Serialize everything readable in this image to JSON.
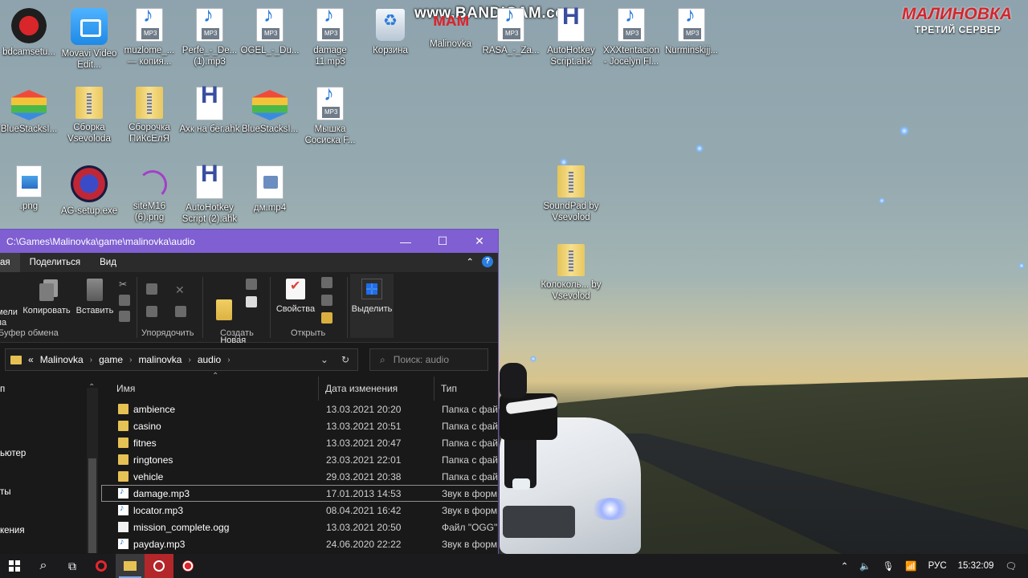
{
  "watermark": "www.BANDICAM.com",
  "brand": {
    "name": "МАЛИНОВКА",
    "server": "ТРЕТИЙ СЕРВЕР"
  },
  "desktop_icons": [
    {
      "label": "bdcamsetu..."
    },
    {
      "label": "Movavi Video Edit..."
    },
    {
      "label": "muzlome_... — копия..."
    },
    {
      "label": "Perfe_-_De... (1).mp3"
    },
    {
      "label": "OGEL_-_Du..."
    },
    {
      "label": "damage 11.mp3"
    },
    {
      "label": "Корзина"
    },
    {
      "label": "Malinovka"
    },
    {
      "label": "RASA_-_Za..."
    },
    {
      "label": "AutoHotkey Script.ahk"
    },
    {
      "label": "XXXtentacion - Jocelyn Fl..."
    },
    {
      "label": "Nurminskijj..."
    },
    {
      "label": "BlueStacksI..."
    },
    {
      "label": "Сборка Vsevoloda"
    },
    {
      "label": "Сборочка ПиКсЕлЯ"
    },
    {
      "label": "Ахк на бег.ahk"
    },
    {
      "label": "BlueStacksI..."
    },
    {
      "label": "Мышка Сосиска F..."
    },
    {
      "label": ".png"
    },
    {
      "label": "AG-setup.exe"
    },
    {
      "label": "siteM16 (6).png"
    },
    {
      "label": "AutoHotkey Script (2).ahk"
    },
    {
      "label": "дм.mp4"
    },
    {
      "label": "SoundPad by Vsevolod"
    },
    {
      "label": "Колоколь... by Vsevolod"
    }
  ],
  "explorer": {
    "title": "C:\\Games\\Malinovka\\game\\malinovka\\audio",
    "tabs": [
      "ая",
      "Поделиться",
      "Вид"
    ],
    "ribbon": {
      "pin": "мели\nпа",
      "copy": "Копировать",
      "paste": "Вставить",
      "new_folder": "Новая\nпапка",
      "properties": "Свойства",
      "select": "Выделить",
      "groups": {
        "clipboard": "Буфер обмена",
        "organize": "Упорядочить",
        "create": "Создать",
        "open": "Открыть"
      }
    },
    "breadcrumb": [
      "Malinovka",
      "game",
      "malinovka",
      "audio"
    ],
    "breadcrumb_prefix": "«",
    "search_placeholder": "Поиск: audio",
    "nav_items": [
      "п",
      "ьютер",
      "ты",
      "кения"
    ],
    "columns": {
      "name": "Имя",
      "date": "Дата изменения",
      "type": "Тип"
    },
    "files": [
      {
        "name": "ambience",
        "date": "13.03.2021 20:20",
        "type": "Папка с фай",
        "kind": "folder"
      },
      {
        "name": "casino",
        "date": "13.03.2021 20:51",
        "type": "Папка с фай",
        "kind": "folder"
      },
      {
        "name": "fitnes",
        "date": "13.03.2021 20:47",
        "type": "Папка с фай",
        "kind": "folder"
      },
      {
        "name": "ringtones",
        "date": "23.03.2021 22:01",
        "type": "Папка с фай",
        "kind": "folder"
      },
      {
        "name": "vehicle",
        "date": "29.03.2021 20:38",
        "type": "Папка с фай",
        "kind": "folder"
      },
      {
        "name": "damage.mp3",
        "date": "17.01.2013 14:53",
        "type": "Звук в форм",
        "kind": "audio"
      },
      {
        "name": "locator.mp3",
        "date": "08.04.2021 16:42",
        "type": "Звук в форм",
        "kind": "audio"
      },
      {
        "name": "mission_complete.ogg",
        "date": "13.03.2021 20:50",
        "type": "Файл \"OGG\"",
        "kind": "file"
      },
      {
        "name": "payday.mp3",
        "date": "24.06.2020 22:22",
        "type": "Звук в форм",
        "kind": "audio"
      }
    ]
  },
  "taskbar": {
    "language": "РУС",
    "time": "15:32:09"
  }
}
